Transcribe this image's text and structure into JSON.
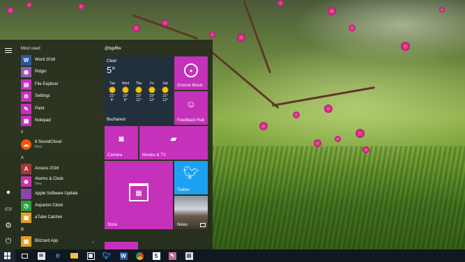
{
  "start_menu": {
    "most_used_label": "Most used",
    "most_used": [
      {
        "label": "Word 2016",
        "color": "#2b579a",
        "glyph": "W"
      },
      {
        "label": "Pidgin",
        "color": "#9b59b6",
        "glyph": "◉"
      },
      {
        "label": "File Explorer",
        "color": "#c531ba",
        "glyph": "▤"
      },
      {
        "label": "Settings",
        "color": "#c531ba",
        "glyph": "⚙"
      },
      {
        "label": "Paint",
        "color": "#c531ba",
        "glyph": "✎"
      },
      {
        "label": "Notepad",
        "color": "#c531ba",
        "glyph": "▦"
      }
    ],
    "section_hash": "#",
    "soundcloud": {
      "label": "8 SoundCloud",
      "badge": "New",
      "color": "#ff5500",
      "glyph": "☁"
    },
    "section_a": "A",
    "a_apps": [
      {
        "label": "Access 2016",
        "color": "#a4373a",
        "glyph": "A"
      },
      {
        "label": "Alarms & Clock",
        "badge": "New",
        "color": "#c531ba",
        "glyph": "⏰"
      },
      {
        "label": "Apple Software Update",
        "color": "#8e44ad",
        "glyph": ""
      },
      {
        "label": "Asparion Clock",
        "color": "#2e9e3e",
        "glyph": "◷"
      },
      {
        "label": "aTube Catcher",
        "color": "#e0a020",
        "glyph": "▣"
      }
    ],
    "section_b": "B",
    "b_apps": [
      {
        "label": "Blizzard App",
        "color": "#e0a020",
        "glyph": "▣"
      }
    ],
    "chevron": "⌄",
    "tiles": {
      "group_title": "@bgdftw",
      "weather": {
        "condition": "Clear",
        "temp": "5°",
        "days": [
          {
            "d": "Tue",
            "hi": "21°",
            "lo": "5°"
          },
          {
            "d": "Wed",
            "hi": "23°",
            "lo": "9°"
          },
          {
            "d": "Thu",
            "hi": "23°",
            "lo": "11°"
          },
          {
            "d": "Fri",
            "hi": "23°",
            "lo": "12°"
          },
          {
            "d": "Sat",
            "hi": "21°",
            "lo": "12°"
          }
        ],
        "city": "Bucharest"
      },
      "groove": "Groove Music",
      "feedback": "Feedback Hub",
      "camera": "Camera",
      "movies": "Movies & TV",
      "store": "Store",
      "twitter": "Twitter",
      "news": "News"
    }
  },
  "colors": {
    "accent": "#c531ba",
    "twitter": "#1da1f2",
    "taskbar": "#101820"
  }
}
